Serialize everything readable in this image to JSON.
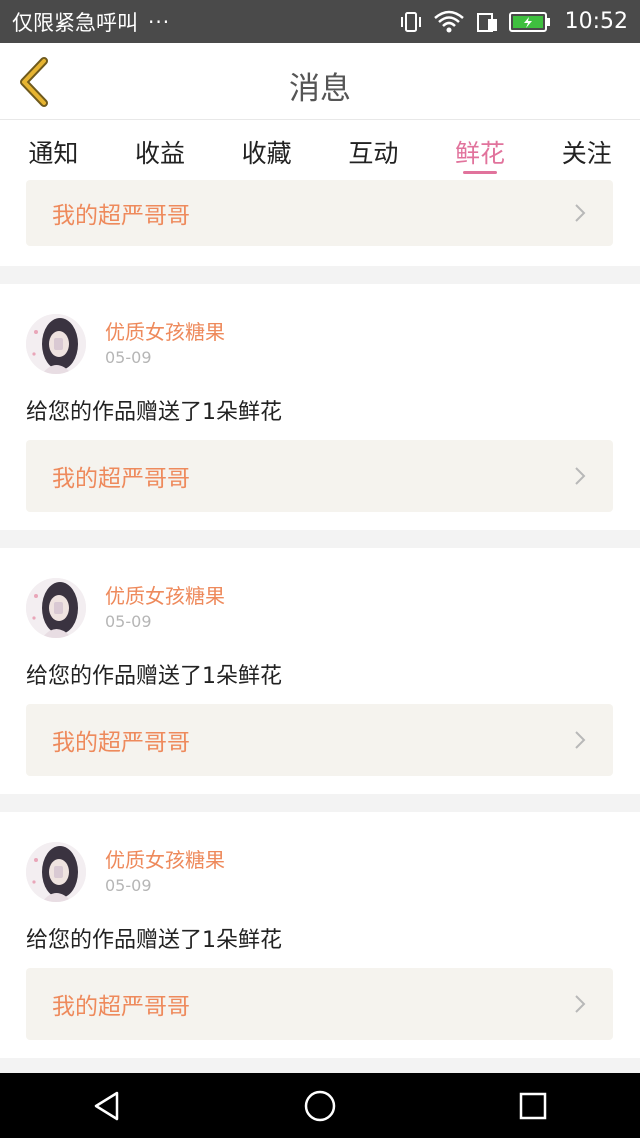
{
  "status_bar": {
    "notification_text": "仅限紧急呼叫",
    "more_indicator": "···",
    "icons": [
      "vibrate-icon",
      "wifi-icon",
      "sim-icon",
      "battery-icon"
    ],
    "time": "10:52"
  },
  "header": {
    "back_icon": "chevron-left-icon",
    "title": "消息"
  },
  "tabs": [
    {
      "label": "通知",
      "active": false
    },
    {
      "label": "收益",
      "active": false
    },
    {
      "label": "收藏",
      "active": false
    },
    {
      "label": "互动",
      "active": false
    },
    {
      "label": "鲜花",
      "active": true
    },
    {
      "label": "关注",
      "active": false
    }
  ],
  "partial_card": {
    "work_title": "我的超严哥哥"
  },
  "messages": [
    {
      "nickname": "优质女孩糖果",
      "date": "05-09",
      "text": "给您的作品赠送了1朵鲜花",
      "work_title": "我的超严哥哥"
    },
    {
      "nickname": "优质女孩糖果",
      "date": "05-09",
      "text": "给您的作品赠送了1朵鲜花",
      "work_title": "我的超严哥哥"
    },
    {
      "nickname": "优质女孩糖果",
      "date": "05-09",
      "text": "给您的作品赠送了1朵鲜花",
      "work_title": "我的超严哥哥"
    }
  ],
  "nav_bar": {
    "buttons": [
      "back-triangle-icon",
      "home-circle-icon",
      "recents-square-icon"
    ]
  },
  "colors": {
    "accent_tab": "#e1739c",
    "work_title": "#ee8a5c",
    "back_arrow": "#e6b431"
  }
}
